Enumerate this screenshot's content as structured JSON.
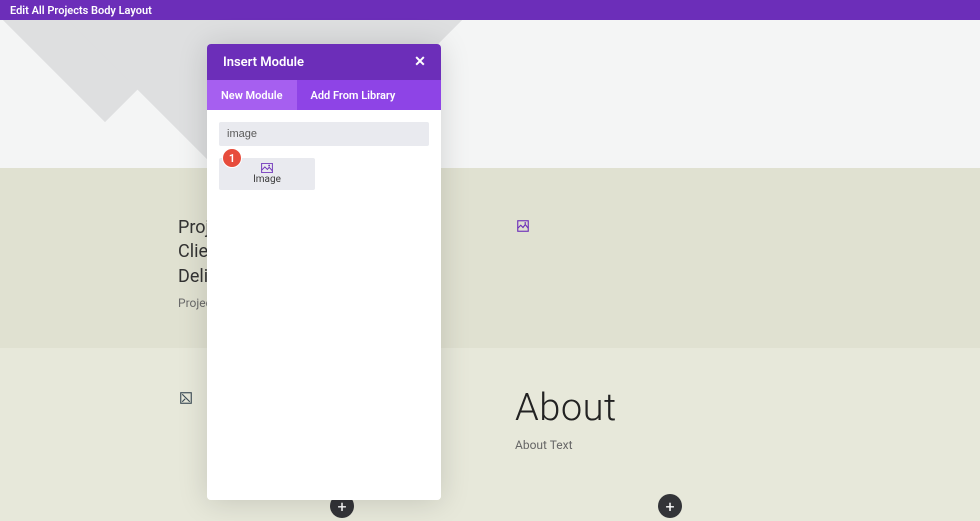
{
  "topbar": {
    "title": "Edit All Projects Body Layout"
  },
  "modal": {
    "title": "Insert Module",
    "tabs": {
      "new": "New Module",
      "library": "Add From Library"
    },
    "search_value": "image",
    "results": [
      {
        "label": "Image"
      }
    ]
  },
  "callout": {
    "number": "1"
  },
  "page": {
    "project_name": "Project Name",
    "client": "Client",
    "deliverable": "Deliverable",
    "description": "Project Description",
    "about_title": "About",
    "about_text": "About Text"
  },
  "icons": {
    "plus": "+",
    "close": "✕"
  },
  "colors": {
    "primary": "#6c2eb9",
    "primary_light": "#8e44e6",
    "callout": "#e74c3c"
  }
}
